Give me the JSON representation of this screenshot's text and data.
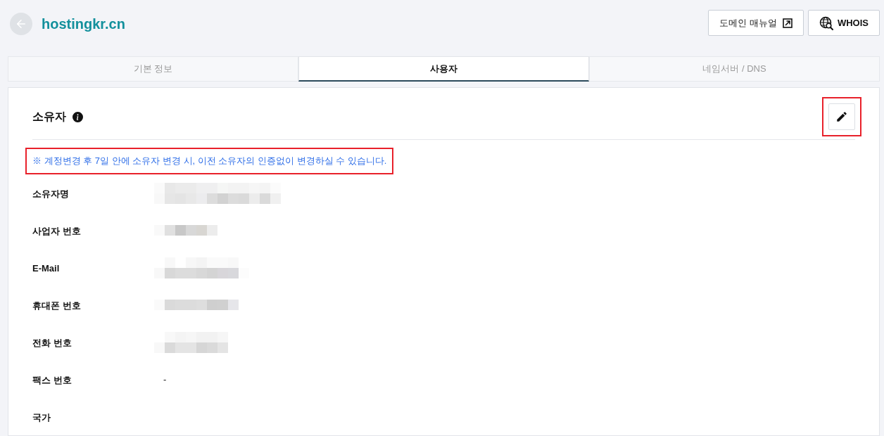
{
  "header": {
    "title": "hostingkr.cn",
    "buttons": [
      {
        "label": "도메인 매뉴얼",
        "kind": "external"
      },
      {
        "label": "WHOIS",
        "kind": "whois"
      }
    ]
  },
  "tabs": [
    {
      "label": "기본 정보",
      "selected": false
    },
    {
      "label": "사용자",
      "selected": true
    },
    {
      "label": "네임서버 / DNS",
      "selected": false
    }
  ],
  "section": {
    "title": "소유자",
    "edit_button": {
      "highlighted": true
    },
    "notice": {
      "text": "※ 계정변경 후 7일 안에 소유자 변경 시, 이전 소유자의 인증없이 변경하실 수 있습니다.",
      "highlighted": true
    },
    "fields": [
      {
        "label": "소유자명",
        "kind": "redacted"
      },
      {
        "label": "사업자 번호",
        "kind": "redacted"
      },
      {
        "label": "E-Mail",
        "kind": "redacted"
      },
      {
        "label": "휴대폰 번호",
        "kind": "redacted"
      },
      {
        "label": "전화 번호",
        "kind": "redacted"
      },
      {
        "label": "팩스 번호",
        "kind": "text",
        "value": "-"
      },
      {
        "label": "국가",
        "kind": "blank"
      }
    ]
  }
}
